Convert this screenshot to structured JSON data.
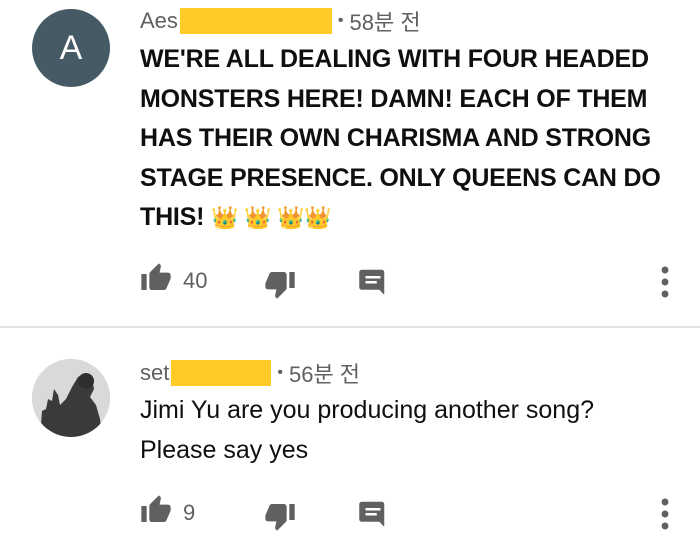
{
  "comments": [
    {
      "avatar_letter": "A",
      "author": "Aes",
      "time": "58분 전",
      "text": "WE'RE ALL DEALING WITH FOUR HEADED MONSTERS HERE! DAMN! EACH OF THEM HAS THEIR OWN CHARISMA AND STRONG STAGE PRESENCE. ONLY QUEENS CAN DO THIS!",
      "emoji": "👑 👑 👑👑",
      "like_count": "40"
    },
    {
      "author": "set",
      "time": "56분 전",
      "text_line1": "Jimi Yu are you producing another song?",
      "text_line2": "Please say yes",
      "like_count": "9"
    }
  ],
  "colors": {
    "redaction": "#ffc926",
    "avatar_a": "#455a64",
    "icon": "#606060"
  },
  "icons": [
    "thumbs-up-icon",
    "thumbs-down-icon",
    "reply-icon",
    "more-vert-icon"
  ]
}
